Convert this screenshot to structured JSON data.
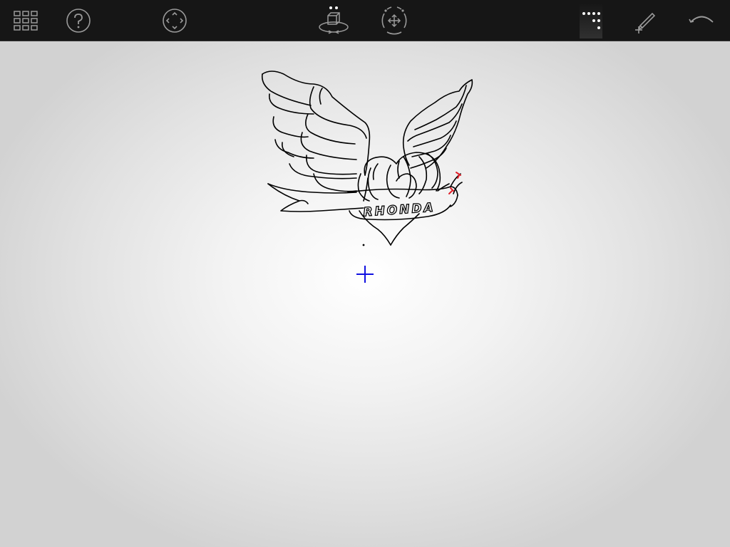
{
  "toolbar": {
    "tools": [
      {
        "id": "grid",
        "icon": "grid-icon"
      },
      {
        "id": "help",
        "icon": "question-mark-icon"
      },
      {
        "id": "pan",
        "icon": "pan-arrows-icon"
      },
      {
        "id": "rotate-3d",
        "icon": "rotate-cube-icon"
      },
      {
        "id": "move",
        "icon": "move-arrows-icon"
      },
      {
        "id": "point-mode",
        "icon": "dots-icon",
        "active": true
      },
      {
        "id": "draw",
        "icon": "pencil-icon"
      },
      {
        "id": "undo",
        "icon": "undo-curve-icon"
      }
    ]
  },
  "drawing": {
    "banner_text": "RHONDA",
    "cursor_color": "#1010e0",
    "stroke_color": "#000000",
    "highlight_color": "#e0202a"
  },
  "colors": {
    "toolbar_bg": "#161616",
    "icon": "#9a9a9a",
    "canvas_center": "#ffffff",
    "canvas_edge": "#d2d2d2"
  }
}
